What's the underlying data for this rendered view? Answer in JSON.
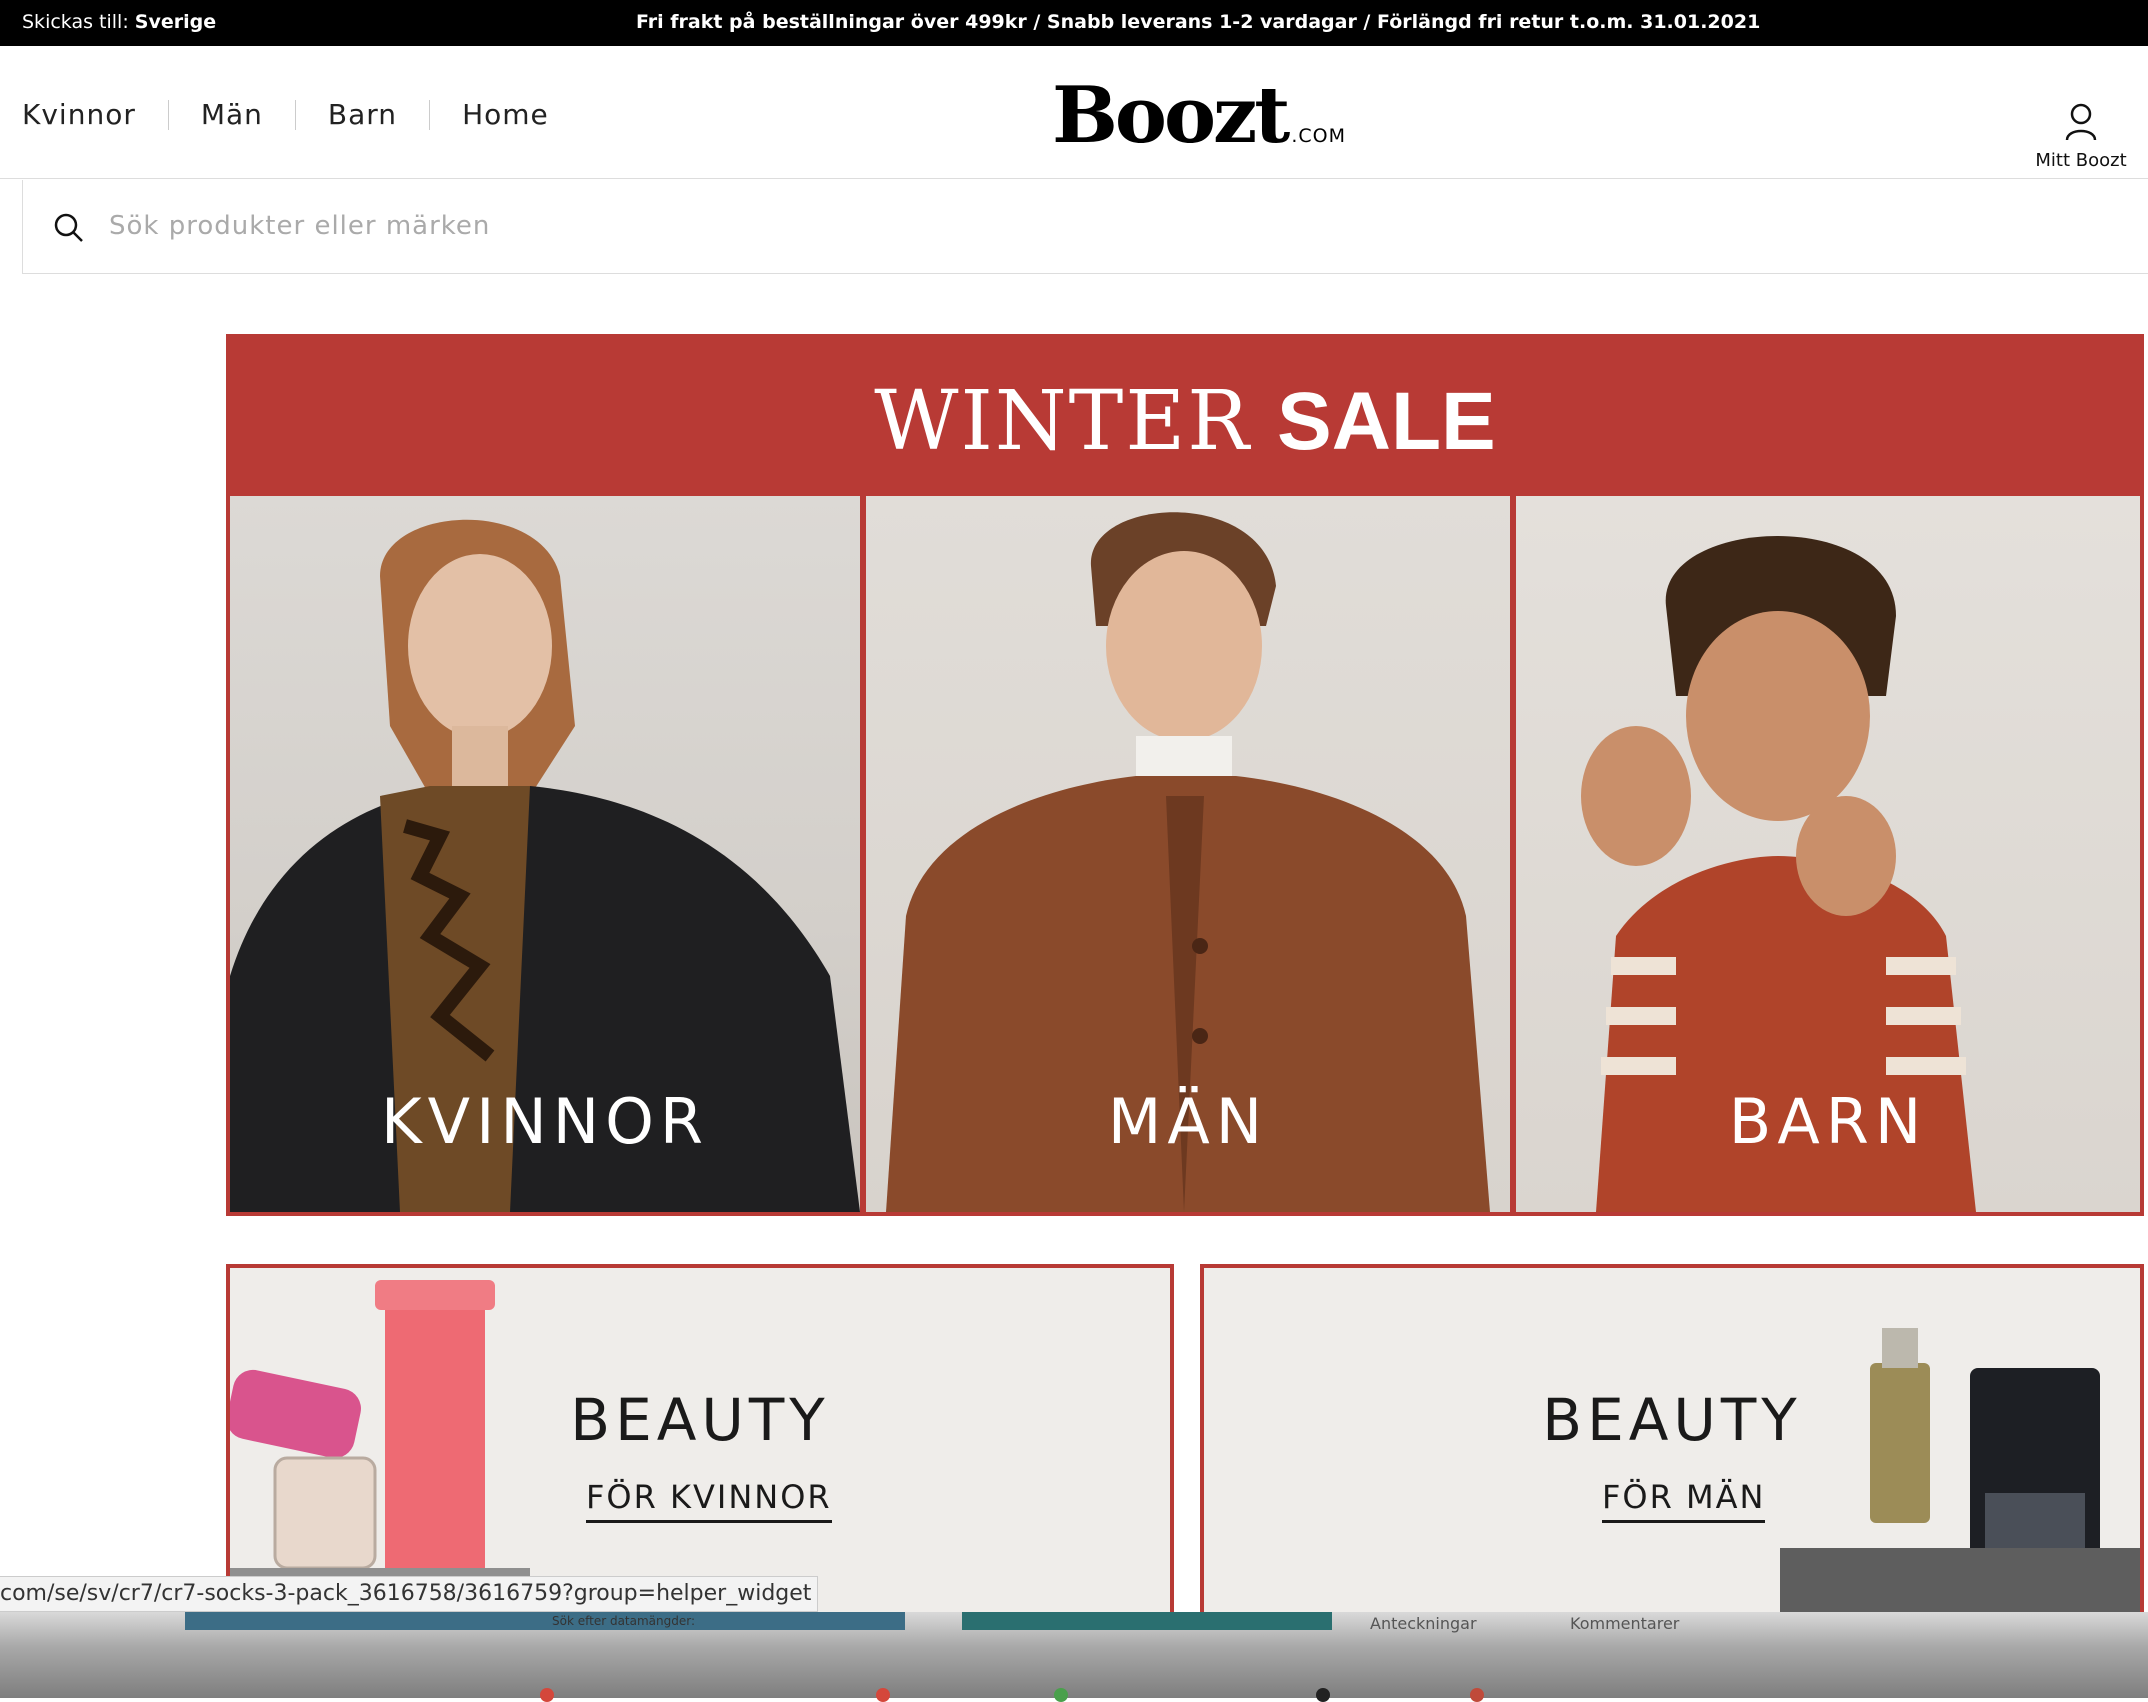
{
  "topbar": {
    "ship_label": "Skickas till:",
    "ship_country": "Sverige",
    "promo": "Fri frakt på beställningar över 499kr   /   Snabb leverans 1-2 vardagar   /   Förlängd fri retur t.o.m. 31.01.2021"
  },
  "nav": {
    "items": [
      "Kvinnor",
      "Män",
      "Barn",
      "Home"
    ]
  },
  "logo": {
    "name": "Boozt",
    "suffix": ".COM"
  },
  "account": {
    "label": "Mitt Boozt"
  },
  "search": {
    "placeholder": "Sök produkter eller märken"
  },
  "banner": {
    "title_a": "WINTER",
    "title_b": "SALE",
    "tiles": [
      "KVINNOR",
      "MÄN",
      "BARN"
    ]
  },
  "cards": [
    {
      "title": "BEAUTY",
      "sub": "FÖR KVINNOR"
    },
    {
      "title": "BEAUTY",
      "sub": "FÖR MÄN"
    }
  ],
  "statusbar": {
    "url": "com/se/sv/cr7/cr7-socks-3-pack_3616758/3616759?group=helper_widget"
  },
  "dock": {
    "snippets": [
      "Sök efter datamängder:",
      "Anteckningar",
      "Kommentarer"
    ]
  },
  "colors": {
    "accent": "#b83a35",
    "topbar": "#000000"
  }
}
